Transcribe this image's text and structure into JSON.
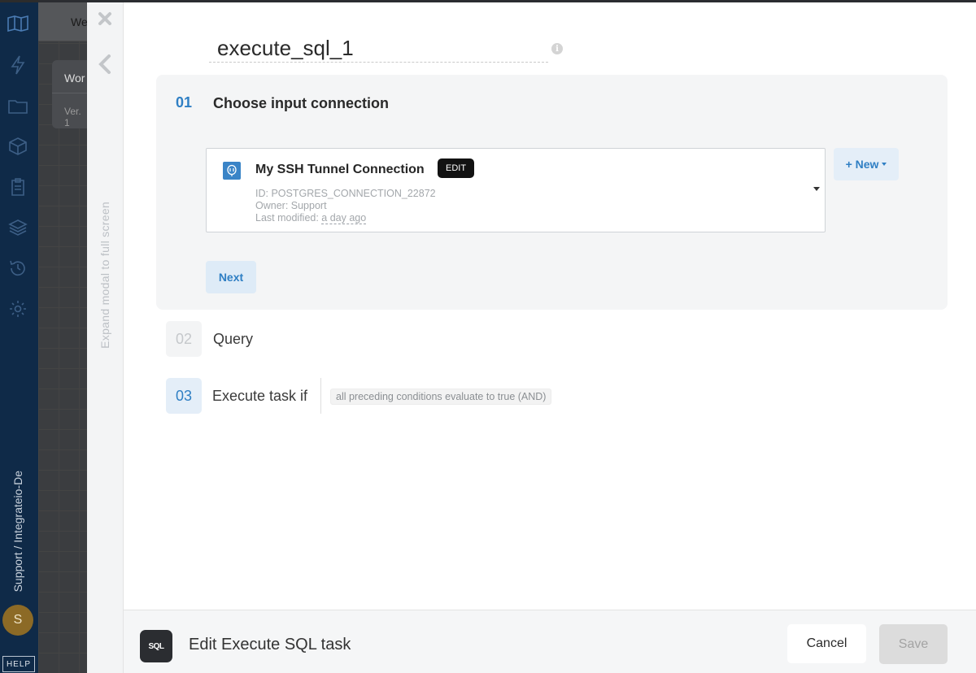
{
  "sidebar": {
    "icons": [
      "logo-icon",
      "lightning-icon",
      "folder-icon",
      "package-icon",
      "clipboard-icon",
      "layers-icon",
      "history-icon",
      "gear-icon"
    ],
    "account_label": "Support / Integrateio-De",
    "avatar_initial": "S",
    "help_label": "HELP"
  },
  "background": {
    "tab_text": "We",
    "card_title": "Wor",
    "card_version": "Ver. 1"
  },
  "modal": {
    "expand_label": "Expand modal to full screen",
    "task_name": "execute_sql_1",
    "step1": {
      "number": "01",
      "title": "Choose input connection",
      "connection": {
        "name": "My SSH Tunnel Connection",
        "edit_label": "EDIT",
        "id_line": "ID: POSTGRES_CONNECTION_22872",
        "owner_line": "Owner: Support",
        "modified_prefix": "Last modified: ",
        "modified_value": "a day ago"
      },
      "new_label": "+ New",
      "next_label": "Next"
    },
    "step2": {
      "number": "02",
      "title": "Query"
    },
    "step3": {
      "number": "03",
      "title": "Execute task if",
      "condition": "all preceding conditions evaluate to true (AND)"
    },
    "footer": {
      "icon_text": "SQL",
      "title": "Edit Execute SQL task",
      "cancel_label": "Cancel",
      "save_label": "Save"
    }
  },
  "colors": {
    "accent": "#2f7fc4",
    "sidebar_bg": "#0f2a48",
    "step_bg": "#f4f5f6"
  }
}
